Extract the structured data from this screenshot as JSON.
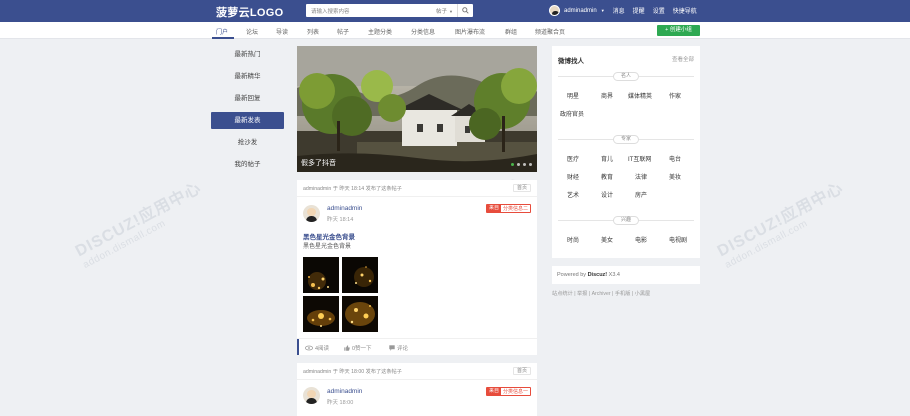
{
  "header": {
    "logo": "菠萝云LOGO",
    "search_placeholder": "请输入搜索内容",
    "search_type": "帖子",
    "username": "adminadmin",
    "links": [
      "消息",
      "提醒",
      "设置",
      "快捷导航"
    ]
  },
  "nav": {
    "items": [
      "门户",
      "论坛",
      "导读",
      "列表",
      "帖子",
      "主题分类",
      "分类信息",
      "图片瀑布流",
      "群组",
      "频道聚合页"
    ],
    "active_index": 0,
    "create_button": "+ 创建小组"
  },
  "left_menu": {
    "items": [
      "最新热门",
      "最新精华",
      "最新回复",
      "最新发表",
      "抢沙发",
      "我的帖子"
    ],
    "active_index": 3
  },
  "slider": {
    "caption": "假多了抖音",
    "slide_count": 4,
    "active_dot": 0
  },
  "posts": [
    {
      "head": "adminadmin 于 昨天 18:14 发布了这条帖子",
      "tag": "首页",
      "author": "adminadmin",
      "time": "昨天 18:14",
      "source_prefix": "来自",
      "source": "分类信息二",
      "title": "黑色星光金色背景",
      "summary": "黑色星光金色背景",
      "views": "4阅读",
      "likes": "0赞一下",
      "comments": "评论"
    },
    {
      "head": "adminadmin 于 昨天 18:00 发布了这条帖子",
      "tag": "首页",
      "author": "adminadmin",
      "time": "昨天 18:00",
      "source_prefix": "来自",
      "source": "分类信息一"
    }
  ],
  "right_panel": {
    "title": "微博找人",
    "view_all": "查看全部",
    "groups": [
      {
        "name": "名人",
        "tags": [
          "明星",
          "商界",
          "媒体精英",
          "作家",
          "政府官员"
        ]
      },
      {
        "name": "专家",
        "tags": [
          "医疗",
          "育儿",
          "IT互联网",
          "电台",
          "财经",
          "教育",
          "法律",
          "美妆",
          "艺术",
          "设计",
          "房产"
        ]
      },
      {
        "name": "兴趣",
        "tags": [
          "时尚",
          "美女",
          "电影",
          "电视剧"
        ]
      }
    ]
  },
  "footer": {
    "powered_prefix": "Powered by",
    "powered_brand": "Discuz!",
    "powered_version": "X3.4",
    "links": "站点统计 | 举报 | Archiver | 手机版 | 小黑屋"
  },
  "watermark": {
    "main": "DISCUZ!应用中心",
    "domain": "addon.dismall.com",
    "brand": "贰道"
  }
}
